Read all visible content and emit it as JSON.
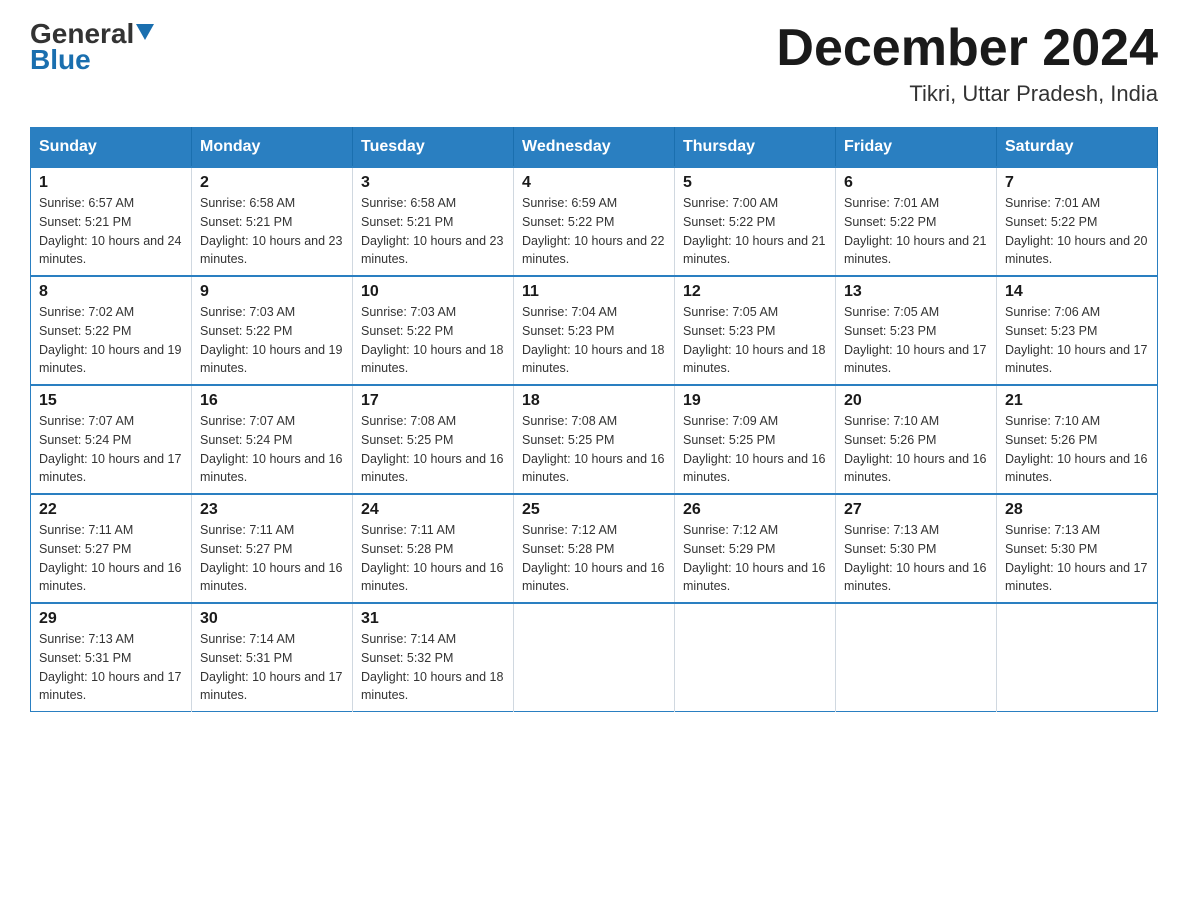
{
  "header": {
    "logo_general": "General",
    "logo_blue": "Blue",
    "title": "December 2024",
    "subtitle": "Tikri, Uttar Pradesh, India"
  },
  "days_of_week": [
    "Sunday",
    "Monday",
    "Tuesday",
    "Wednesday",
    "Thursday",
    "Friday",
    "Saturday"
  ],
  "weeks": [
    [
      {
        "day": "1",
        "sunrise": "6:57 AM",
        "sunset": "5:21 PM",
        "daylight": "10 hours and 24 minutes."
      },
      {
        "day": "2",
        "sunrise": "6:58 AM",
        "sunset": "5:21 PM",
        "daylight": "10 hours and 23 minutes."
      },
      {
        "day": "3",
        "sunrise": "6:58 AM",
        "sunset": "5:21 PM",
        "daylight": "10 hours and 23 minutes."
      },
      {
        "day": "4",
        "sunrise": "6:59 AM",
        "sunset": "5:22 PM",
        "daylight": "10 hours and 22 minutes."
      },
      {
        "day": "5",
        "sunrise": "7:00 AM",
        "sunset": "5:22 PM",
        "daylight": "10 hours and 21 minutes."
      },
      {
        "day": "6",
        "sunrise": "7:01 AM",
        "sunset": "5:22 PM",
        "daylight": "10 hours and 21 minutes."
      },
      {
        "day": "7",
        "sunrise": "7:01 AM",
        "sunset": "5:22 PM",
        "daylight": "10 hours and 20 minutes."
      }
    ],
    [
      {
        "day": "8",
        "sunrise": "7:02 AM",
        "sunset": "5:22 PM",
        "daylight": "10 hours and 19 minutes."
      },
      {
        "day": "9",
        "sunrise": "7:03 AM",
        "sunset": "5:22 PM",
        "daylight": "10 hours and 19 minutes."
      },
      {
        "day": "10",
        "sunrise": "7:03 AM",
        "sunset": "5:22 PM",
        "daylight": "10 hours and 18 minutes."
      },
      {
        "day": "11",
        "sunrise": "7:04 AM",
        "sunset": "5:23 PM",
        "daylight": "10 hours and 18 minutes."
      },
      {
        "day": "12",
        "sunrise": "7:05 AM",
        "sunset": "5:23 PM",
        "daylight": "10 hours and 18 minutes."
      },
      {
        "day": "13",
        "sunrise": "7:05 AM",
        "sunset": "5:23 PM",
        "daylight": "10 hours and 17 minutes."
      },
      {
        "day": "14",
        "sunrise": "7:06 AM",
        "sunset": "5:23 PM",
        "daylight": "10 hours and 17 minutes."
      }
    ],
    [
      {
        "day": "15",
        "sunrise": "7:07 AM",
        "sunset": "5:24 PM",
        "daylight": "10 hours and 17 minutes."
      },
      {
        "day": "16",
        "sunrise": "7:07 AM",
        "sunset": "5:24 PM",
        "daylight": "10 hours and 16 minutes."
      },
      {
        "day": "17",
        "sunrise": "7:08 AM",
        "sunset": "5:25 PM",
        "daylight": "10 hours and 16 minutes."
      },
      {
        "day": "18",
        "sunrise": "7:08 AM",
        "sunset": "5:25 PM",
        "daylight": "10 hours and 16 minutes."
      },
      {
        "day": "19",
        "sunrise": "7:09 AM",
        "sunset": "5:25 PM",
        "daylight": "10 hours and 16 minutes."
      },
      {
        "day": "20",
        "sunrise": "7:10 AM",
        "sunset": "5:26 PM",
        "daylight": "10 hours and 16 minutes."
      },
      {
        "day": "21",
        "sunrise": "7:10 AM",
        "sunset": "5:26 PM",
        "daylight": "10 hours and 16 minutes."
      }
    ],
    [
      {
        "day": "22",
        "sunrise": "7:11 AM",
        "sunset": "5:27 PM",
        "daylight": "10 hours and 16 minutes."
      },
      {
        "day": "23",
        "sunrise": "7:11 AM",
        "sunset": "5:27 PM",
        "daylight": "10 hours and 16 minutes."
      },
      {
        "day": "24",
        "sunrise": "7:11 AM",
        "sunset": "5:28 PM",
        "daylight": "10 hours and 16 minutes."
      },
      {
        "day": "25",
        "sunrise": "7:12 AM",
        "sunset": "5:28 PM",
        "daylight": "10 hours and 16 minutes."
      },
      {
        "day": "26",
        "sunrise": "7:12 AM",
        "sunset": "5:29 PM",
        "daylight": "10 hours and 16 minutes."
      },
      {
        "day": "27",
        "sunrise": "7:13 AM",
        "sunset": "5:30 PM",
        "daylight": "10 hours and 16 minutes."
      },
      {
        "day": "28",
        "sunrise": "7:13 AM",
        "sunset": "5:30 PM",
        "daylight": "10 hours and 17 minutes."
      }
    ],
    [
      {
        "day": "29",
        "sunrise": "7:13 AM",
        "sunset": "5:31 PM",
        "daylight": "10 hours and 17 minutes."
      },
      {
        "day": "30",
        "sunrise": "7:14 AM",
        "sunset": "5:31 PM",
        "daylight": "10 hours and 17 minutes."
      },
      {
        "day": "31",
        "sunrise": "7:14 AM",
        "sunset": "5:32 PM",
        "daylight": "10 hours and 18 minutes."
      },
      null,
      null,
      null,
      null
    ]
  ]
}
